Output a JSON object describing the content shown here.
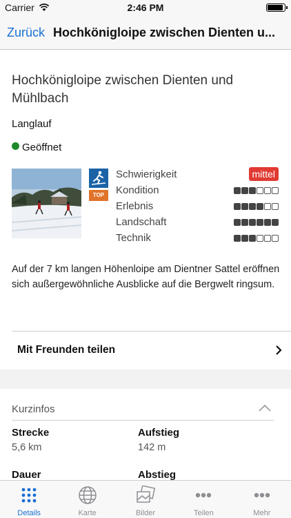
{
  "status_bar": {
    "carrier": "Carrier",
    "time": "2:46 PM"
  },
  "nav": {
    "back_label": "Zurück",
    "title": "Hochkönigloipe zwischen Dienten u..."
  },
  "tour": {
    "title": "Hochkönigloipe zwischen Dienten und Mühlbach",
    "type": "Langlauf",
    "status": "Geöffnet",
    "status_color": "#1e8a2a",
    "badge": "TOP",
    "ratings": [
      {
        "label": "Schwierigkeit",
        "value": "mittel"
      },
      {
        "label": "Kondition",
        "level": 3,
        "max": 6
      },
      {
        "label": "Erlebnis",
        "level": 4,
        "max": 6
      },
      {
        "label": "Landschaft",
        "level": 6,
        "max": 6
      },
      {
        "label": "Technik",
        "level": 3,
        "max": 6
      }
    ],
    "description": "Auf der 7 km langen Höhenloipe am Dientner Sattel eröffnen sich außergewöhnliche Ausblicke auf die Bergwelt ringsum."
  },
  "share": {
    "label": "Mit Freunden teilen"
  },
  "kurzinfos": {
    "title": "Kurzinfos",
    "items": [
      {
        "label": "Strecke",
        "value": "5,6 km"
      },
      {
        "label": "Aufstieg",
        "value": "142 m"
      },
      {
        "label": "Dauer",
        "value": ""
      },
      {
        "label": "Abstieg",
        "value": ""
      }
    ]
  },
  "tabs": [
    {
      "label": "Details",
      "icon": "grid-dots-icon",
      "active": true
    },
    {
      "label": "Karte",
      "icon": "globe-icon",
      "active": false
    },
    {
      "label": "Bilder",
      "icon": "photos-icon",
      "active": false
    },
    {
      "label": "Teilen",
      "icon": "dots-icon",
      "active": false
    },
    {
      "label": "Mehr",
      "icon": "dots-icon",
      "active": false
    }
  ],
  "colors": {
    "accent": "#1b6fd1",
    "difficulty": "#e03a32",
    "top_badge": "#e0722a",
    "activity_icon": "#1b63a6"
  }
}
